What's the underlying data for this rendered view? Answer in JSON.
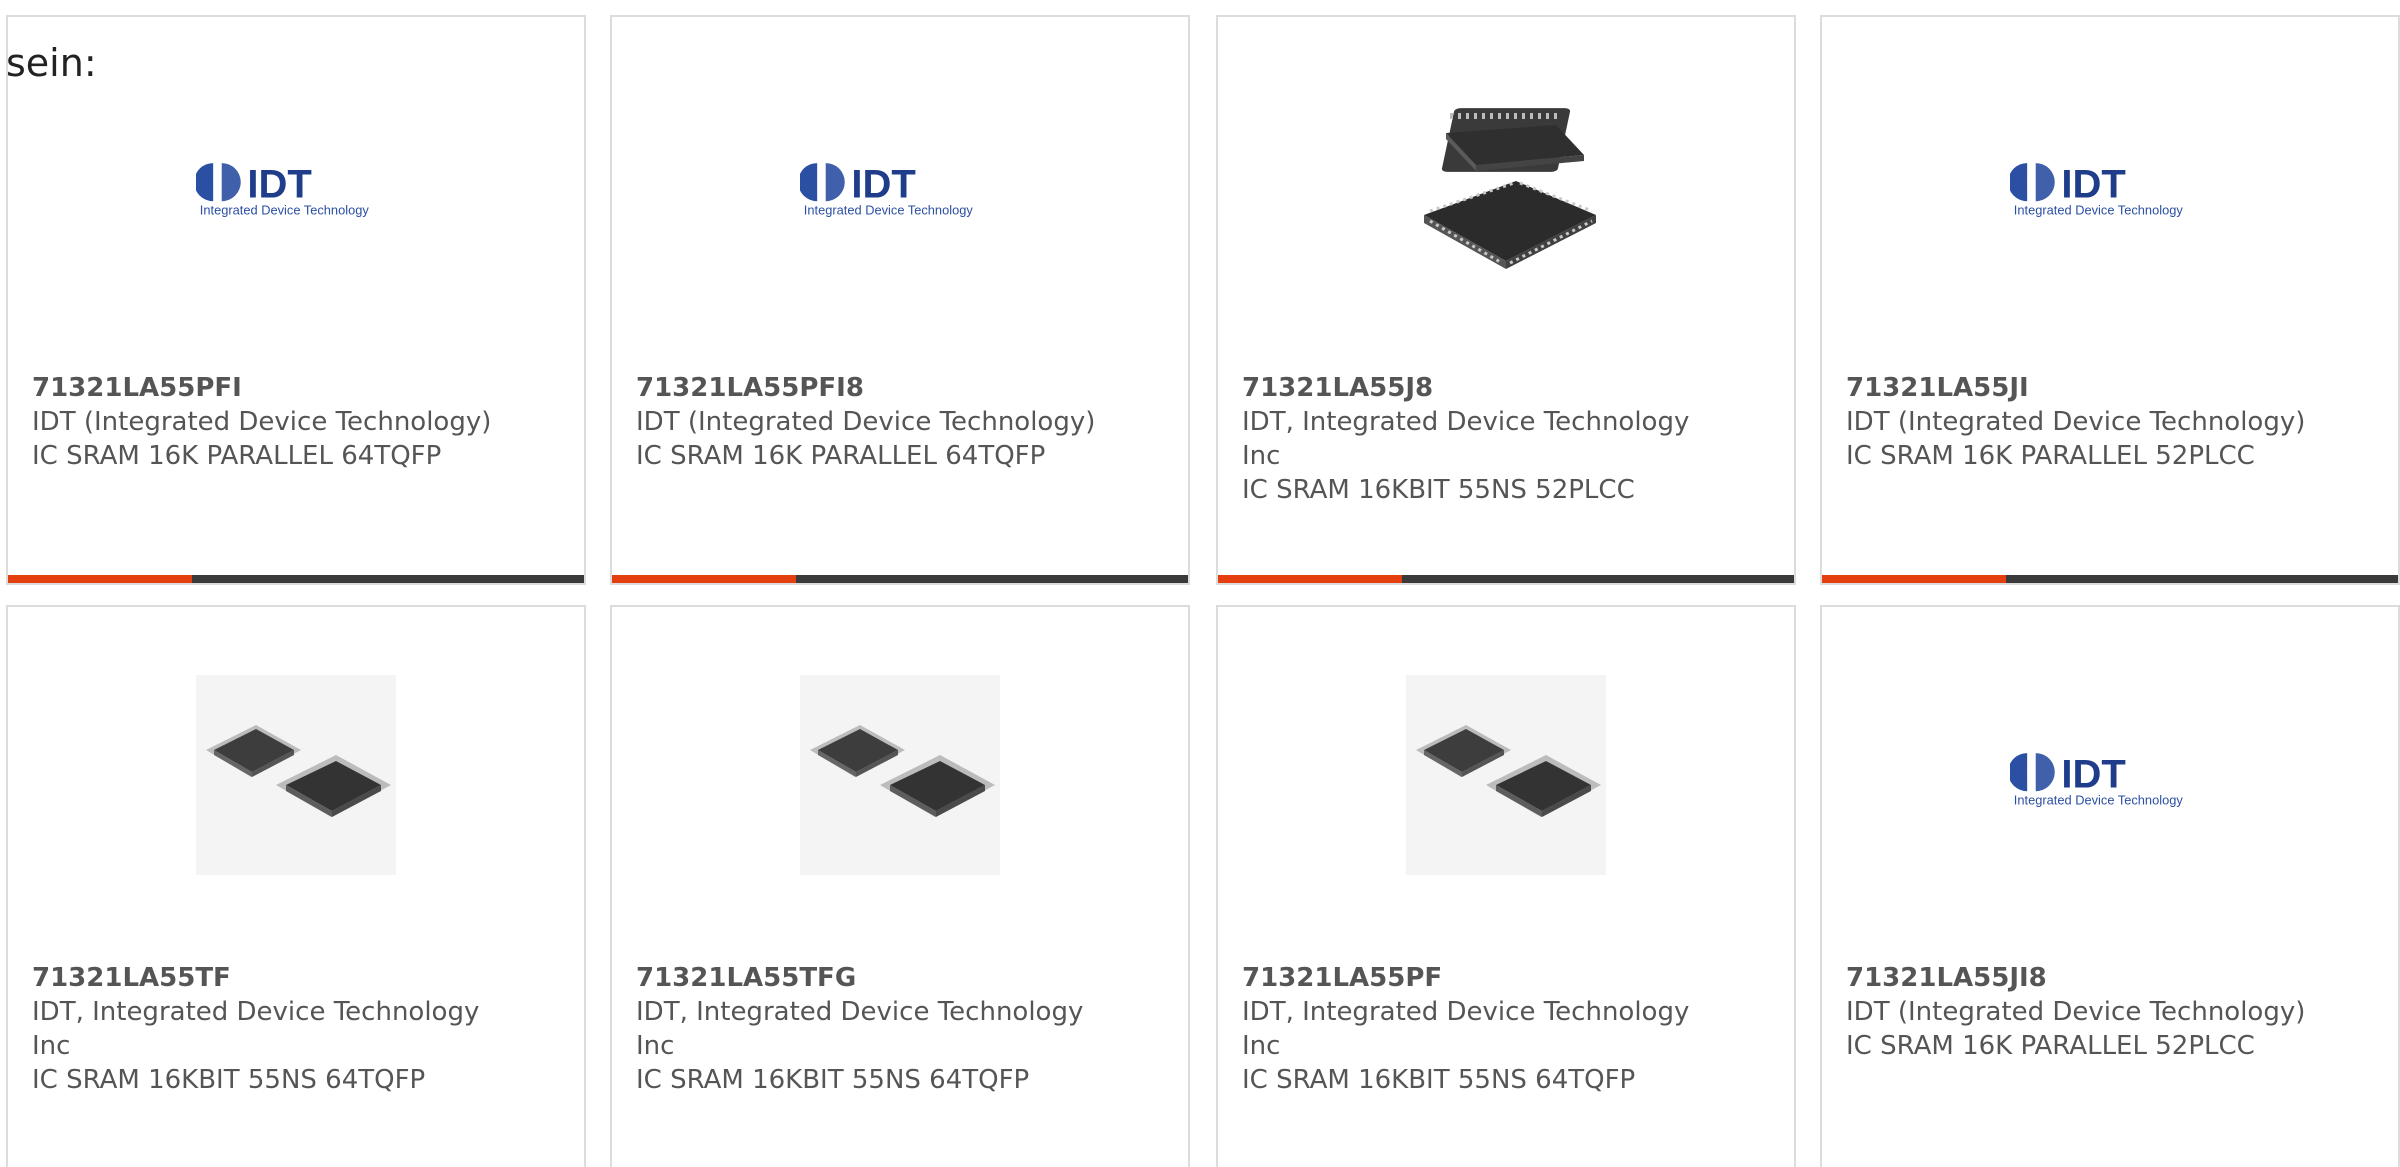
{
  "intro_text": "sein:",
  "colors": {
    "accent": "#e4400f",
    "bar_track": "#3a3a3a",
    "text": "#555555",
    "card_border": "#dcdcdc"
  },
  "cards": [
    {
      "part_number": "71321LA55PFI",
      "manufacturer": "IDT (Integrated Device Technology)",
      "description": "IC SRAM 16K PARALLEL 64TQFP",
      "image": "idt-logo",
      "logo_title": "IDT",
      "logo_subtitle": "Integrated Device Technology",
      "progress": 0.32
    },
    {
      "part_number": "71321LA55PFI8",
      "manufacturer": "IDT (Integrated Device Technology)",
      "description": "IC SRAM 16K PARALLEL 64TQFP",
      "image": "idt-logo",
      "logo_title": "IDT",
      "logo_subtitle": "Integrated Device Technology",
      "progress": 0.32
    },
    {
      "part_number": "71321LA55J8",
      "manufacturer": "IDT, Integrated Device Technology Inc",
      "description": "IC SRAM 16KBIT 55NS 52PLCC",
      "image": "plcc-chip",
      "progress": 0.32
    },
    {
      "part_number": "71321LA55JI",
      "manufacturer": "IDT (Integrated Device Technology)",
      "description": "IC SRAM 16K PARALLEL 52PLCC",
      "image": "idt-logo",
      "logo_title": "IDT",
      "logo_subtitle": "Integrated Device Technology",
      "progress": 0.32
    },
    {
      "part_number": "71321LA55TF",
      "manufacturer": "IDT, Integrated Device Technology Inc",
      "description": "IC SRAM 16KBIT 55NS 64TQFP",
      "image": "tqfp-chips",
      "progress": null
    },
    {
      "part_number": "71321LA55TFG",
      "manufacturer": "IDT, Integrated Device Technology Inc",
      "description": "IC SRAM 16KBIT 55NS 64TQFP",
      "image": "tqfp-chips",
      "progress": null
    },
    {
      "part_number": "71321LA55PF",
      "manufacturer": "IDT, Integrated Device Technology Inc",
      "description": "IC SRAM 16KBIT 55NS 64TQFP",
      "image": "tqfp-chips",
      "progress": null
    },
    {
      "part_number": "71321LA55JI8",
      "manufacturer": "IDT (Integrated Device Technology)",
      "description": "IC SRAM 16K PARALLEL 52PLCC",
      "image": "idt-logo",
      "logo_title": "IDT",
      "logo_subtitle": "Integrated Device Technology",
      "progress": null
    }
  ]
}
